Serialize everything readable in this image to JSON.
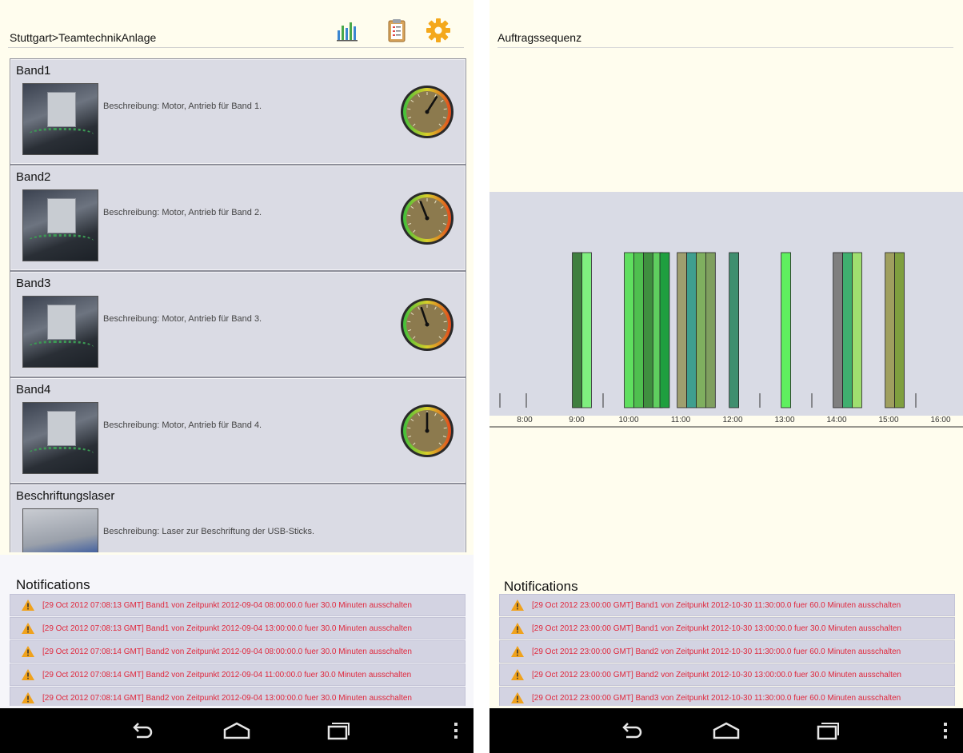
{
  "left": {
    "breadcrumb": "Stuttgart>TeamtechnikAnlage",
    "header_icons": [
      "bar-chart-icon",
      "clipboard-icon",
      "gear-icon"
    ],
    "machines": [
      {
        "name": "Band1",
        "description": "Beschreibung: Motor, Antrieb für Band 1.",
        "gauge_value": 0.62
      },
      {
        "name": "Band2",
        "description": "Beschreibung: Motor, Antrieb für Band 2.",
        "gauge_value": 0.42
      },
      {
        "name": "Band3",
        "description": "Beschreibung: Motor, Antrieb für Band 3.",
        "gauge_value": 0.43
      },
      {
        "name": "Band4",
        "description": "Beschreibung: Motor, Antrieb für Band 4.",
        "gauge_value": 0.5
      },
      {
        "name": "Beschriftungslaser",
        "description": "Beschreibung: Laser zur Beschriftung der USB-Sticks."
      }
    ],
    "notifications_title": "Notifications",
    "notifications": [
      "[29 Oct 2012 07:08:13 GMT] Band1 von Zeitpunkt 2012-09-04 08:00:00.0 fuer 30.0 Minuten ausschalten",
      "[29 Oct 2012 07:08:13 GMT] Band1 von Zeitpunkt 2012-09-04 13:00:00.0 fuer 30.0 Minuten ausschalten",
      "[29 Oct 2012 07:08:14 GMT] Band2 von Zeitpunkt 2012-09-04 08:00:00.0 fuer 30.0 Minuten ausschalten",
      "[29 Oct 2012 07:08:14 GMT] Band2 von Zeitpunkt 2012-09-04 11:00:00.0 fuer 30.0 Minuten ausschalten",
      "[29 Oct 2012 07:08:14 GMT] Band2 von Zeitpunkt 2012-09-04 13:00:00.0 fuer 30.0 Minuten ausschalten"
    ]
  },
  "right": {
    "title": "Auftragssequenz",
    "notifications_title": "Notifications",
    "notifications": [
      "[29 Oct 2012 23:00:00 GMT] Band1 von Zeitpunkt 2012-10-30 11:30:00.0 fuer 60.0 Minuten ausschalten",
      "[29 Oct 2012 23:00:00 GMT] Band1 von Zeitpunkt 2012-10-30 13:00:00.0 fuer 30.0 Minuten ausschalten",
      "[29 Oct 2012 23:00:00 GMT] Band2 von Zeitpunkt 2012-10-30 11:30:00.0 fuer 60.0 Minuten ausschalten",
      "[29 Oct 2012 23:00:00 GMT] Band2 von Zeitpunkt 2012-10-30 13:00:00.0 fuer 30.0 Minuten ausschalten",
      "[29 Oct 2012 23:00:00 GMT] Band3 von Zeitpunkt 2012-10-30 11:30:00.0 fuer 60.0 Minuten ausschalten"
    ]
  },
  "chart_data": {
    "type": "bar",
    "title": "Auftragssequenz",
    "xlim": [
      "7:30",
      "16:00"
    ],
    "xticks": [
      "8:00",
      "9:00",
      "10:00",
      "11:00",
      "12:00",
      "13:00",
      "14:00",
      "15:00",
      "16:00"
    ],
    "bars": [
      {
        "start": "8:55",
        "end": "9:06",
        "color": "#3f7f3f"
      },
      {
        "start": "9:06",
        "end": "9:17",
        "color": "#7fef7f"
      },
      {
        "start": "9:55",
        "end": "10:06",
        "color": "#5fdf5f"
      },
      {
        "start": "10:06",
        "end": "10:17",
        "color": "#4fbf4f"
      },
      {
        "start": "10:17",
        "end": "10:28",
        "color": "#3f8f3f"
      },
      {
        "start": "10:28",
        "end": "10:39",
        "color": "#5fcf5f"
      },
      {
        "start": "10:36",
        "end": "10:47",
        "color": "#1f9f3f"
      },
      {
        "start": "10:56",
        "end": "11:07",
        "color": "#9f9f6f"
      },
      {
        "start": "11:07",
        "end": "11:18",
        "color": "#3f9f8f"
      },
      {
        "start": "11:18",
        "end": "11:29",
        "color": "#7faf5f"
      },
      {
        "start": "11:29",
        "end": "11:40",
        "color": "#7f9f5f"
      },
      {
        "start": "11:56",
        "end": "12:07",
        "color": "#3f8f6f"
      },
      {
        "start": "12:56",
        "end": "13:07",
        "color": "#5fef5f"
      },
      {
        "start": "13:56",
        "end": "14:07",
        "color": "#7f7f7f"
      },
      {
        "start": "14:07",
        "end": "14:18",
        "color": "#3faf6f"
      },
      {
        "start": "14:18",
        "end": "14:29",
        "color": "#9fdf6f"
      },
      {
        "start": "14:56",
        "end": "15:07",
        "color": "#9f9f5f"
      },
      {
        "start": "15:07",
        "end": "15:18",
        "color": "#7f9f3f"
      }
    ]
  }
}
